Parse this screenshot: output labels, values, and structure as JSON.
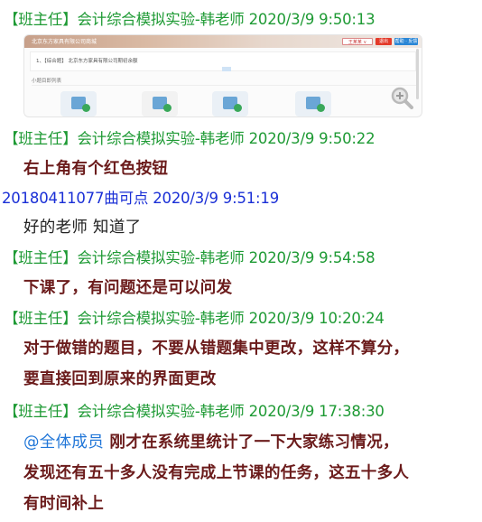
{
  "messages": [
    {
      "sender": "【班主任】会计综合模拟实验-韩老师",
      "time": "2020/3/9 9:50:13"
    },
    {
      "sender": "【班主任】会计综合模拟实验-韩老师",
      "time": "2020/3/9 9:50:22",
      "text": "右上角有个红色按钮"
    },
    {
      "sender": "20180411077曲可点",
      "time": "2020/3/9 9:51:19",
      "text": "好的老师 知道了"
    },
    {
      "sender": "【班主任】会计综合模拟实验-韩老师",
      "time": "2020/3/9 9:54:58",
      "text": "下课了，有问题还是可以问发"
    },
    {
      "sender": "【班主任】会计综合模拟实验-韩老师",
      "time": "2020/3/9 10:20:24",
      "lines": [
        "对于做错的题目，不要从错题集中更改，这样不算分，",
        "要直接回到原来的界面更改"
      ]
    },
    {
      "sender": "【班主任】会计综合模拟实验-韩老师",
      "time": "2020/3/9 17:38:30",
      "mention": "@全体成员",
      "lines": [
        "刚才在系统里统计了一下大家练习情况，",
        "发现还有五十多人没有完成上节课的任务，这五十多人",
        "有时间补上"
      ]
    }
  ],
  "screenshot": {
    "brand": "北京东方家具有限公司商城",
    "btn_user": "王某某 ∨",
    "btn_red": "退出",
    "btn_blue": "帮助 · 反馈",
    "row": "1、【综合题】 北京东方家具有限公司期初余额",
    "sub": "小题目即列表"
  },
  "colors": {
    "teacher": "#1e9a34",
    "student": "#1a2fd6",
    "bold_text": "#6b1b1b",
    "mention": "#2277d8"
  }
}
